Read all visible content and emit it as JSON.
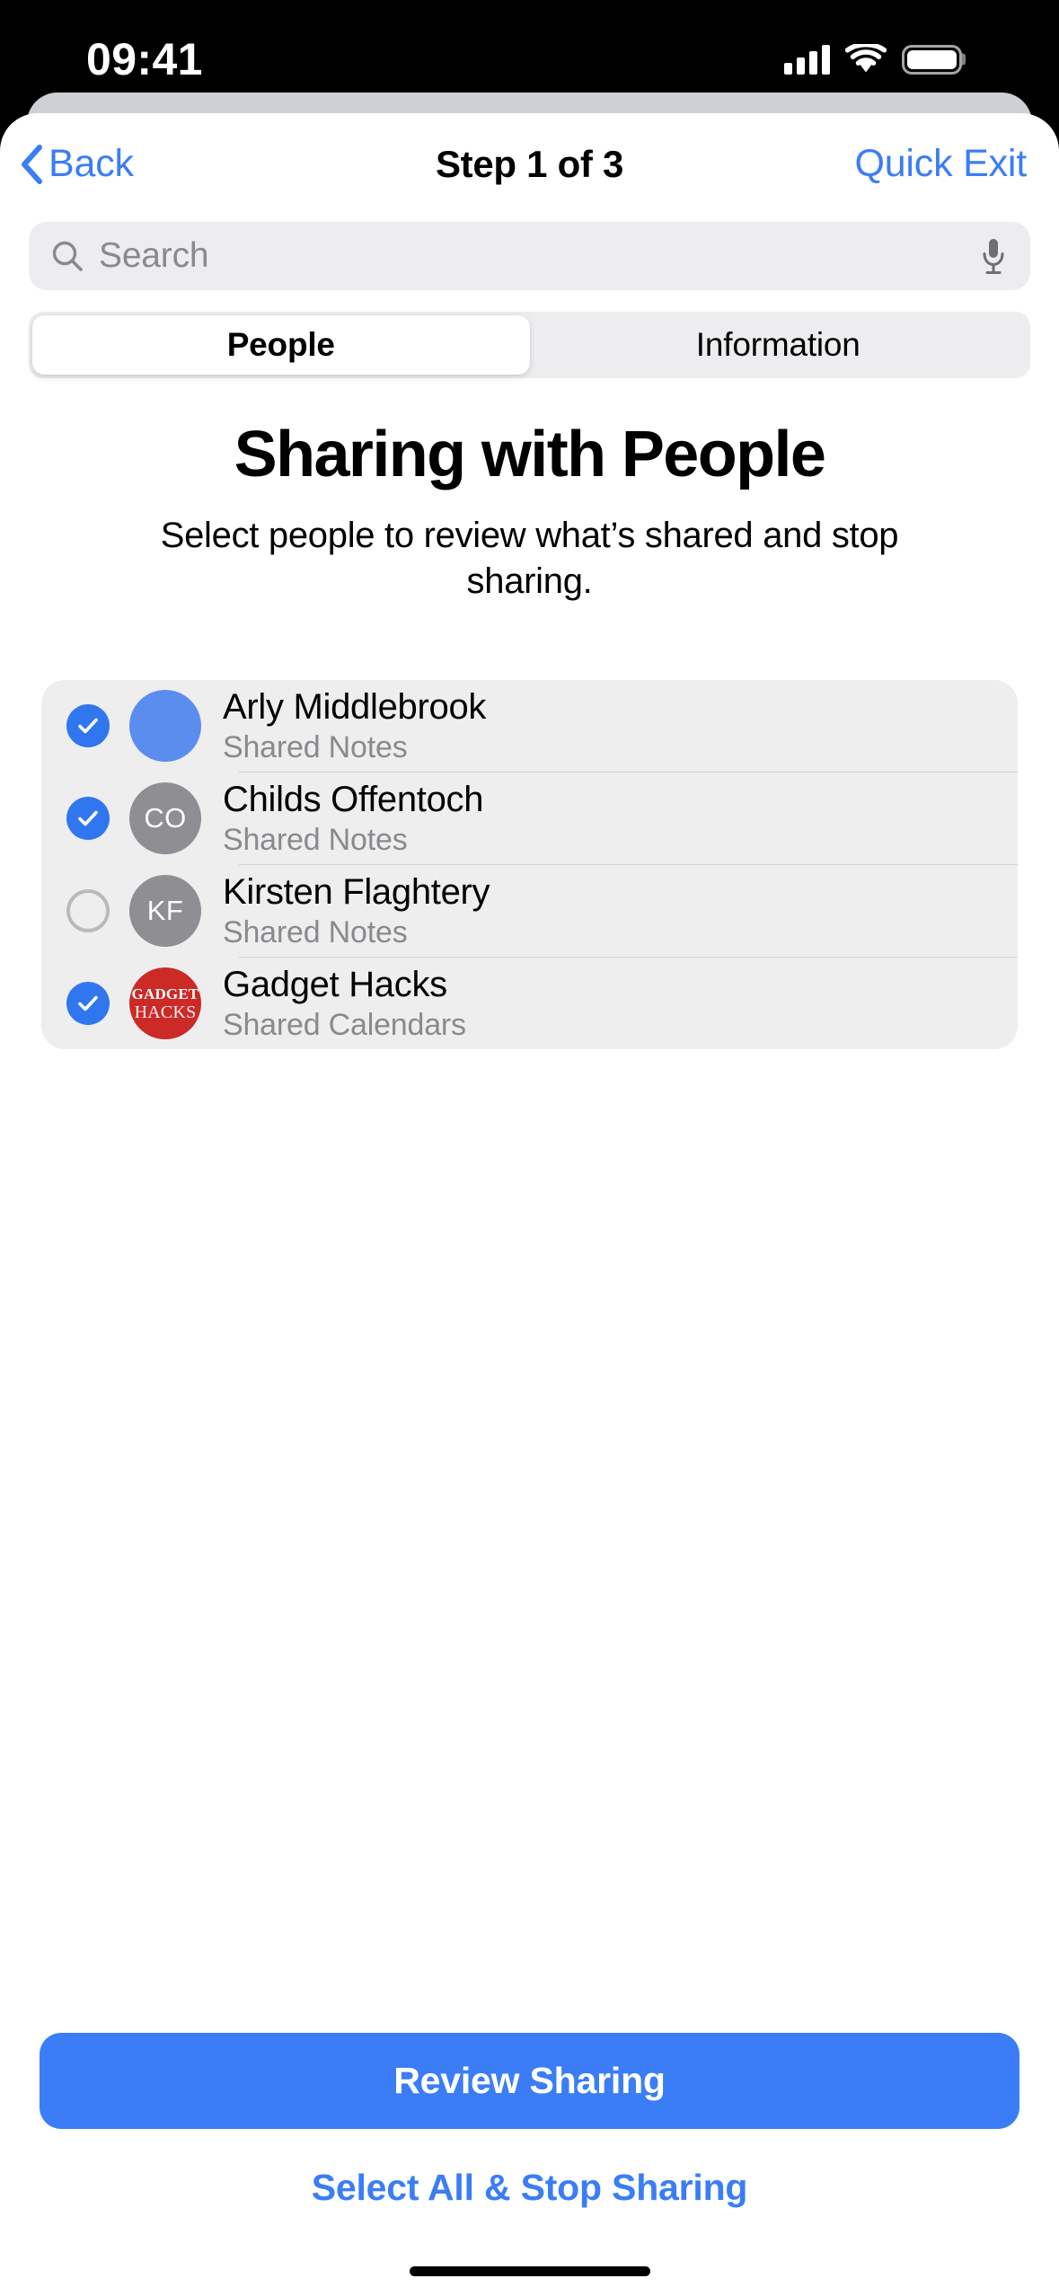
{
  "status_bar": {
    "time": "09:41",
    "cellular_icon": "cellular-bars-icon",
    "wifi_icon": "wifi-icon",
    "battery_icon": "battery-full-icon"
  },
  "nav": {
    "back_label": "Back",
    "back_icon": "chevron-left-icon",
    "title": "Step 1 of 3",
    "quick_exit_label": "Quick Exit"
  },
  "search": {
    "placeholder": "Search",
    "value": "",
    "search_icon": "search-icon",
    "mic_icon": "microphone-icon"
  },
  "segmented": {
    "options": [
      {
        "label": "People",
        "selected": true
      },
      {
        "label": "Information",
        "selected": false
      }
    ]
  },
  "main": {
    "headline": "Sharing with People",
    "subhead": "Select people to review what’s shared and stop sharing."
  },
  "people": [
    {
      "name": "Arly Middlebrook",
      "subtitle": "Shared Notes",
      "checked": true,
      "avatar_type": "solid",
      "avatar_initials": "",
      "avatar_color": "#5b8def"
    },
    {
      "name": "Childs Offentoch",
      "subtitle": "Shared Notes",
      "checked": true,
      "avatar_type": "initials",
      "avatar_initials": "CO",
      "avatar_color": "#8e8e93"
    },
    {
      "name": "Kirsten Flaghtery",
      "subtitle": "Shared Notes",
      "checked": false,
      "avatar_type": "initials",
      "avatar_initials": "KF",
      "avatar_color": "#8e8e93"
    },
    {
      "name": "Gadget Hacks",
      "subtitle": "Shared Calendars",
      "checked": true,
      "avatar_type": "logo",
      "avatar_logo_top": "GADGET",
      "avatar_logo_bottom": "HACKS",
      "avatar_color": "#cc2a26"
    }
  ],
  "footer": {
    "primary_button": "Review Sharing",
    "secondary_link": "Select All & Stop Sharing"
  },
  "colors": {
    "accent_blue": "#3b7df6",
    "check_blue": "#2f76ef",
    "card_gray": "#eeeeef",
    "field_gray": "#ededef",
    "secondary_text": "#8a8a8e",
    "brand_red": "#cc2a26"
  }
}
